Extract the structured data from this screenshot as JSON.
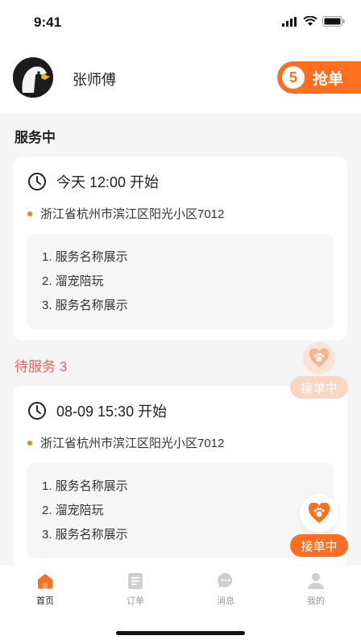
{
  "status_bar": {
    "time": "9:41"
  },
  "header": {
    "user_name": "张师傅",
    "grab_count": "5",
    "grab_label": "抢单"
  },
  "sections": {
    "in_service_title": "服务中",
    "pending_title": "待服务 3"
  },
  "orders": [
    {
      "time": "今天 12:00 开始",
      "address": "浙江省杭州市滨江区阳光小区7012",
      "services": [
        "1. 服务名称展示",
        "2. 溜宠陪玩",
        "3. 服务名称展示"
      ]
    },
    {
      "time": "08-09 15:30 开始",
      "address": "浙江省杭州市滨江区阳光小区7012",
      "services": [
        "1. 服务名称展示",
        "2. 溜宠陪玩",
        "3. 服务名称展示"
      ]
    }
  ],
  "floating": {
    "inactive_label": "接单中",
    "active_label": "接单中"
  },
  "tabbar": {
    "items": [
      {
        "label": "首页",
        "icon": "home-icon"
      },
      {
        "label": "订单",
        "icon": "order-icon"
      },
      {
        "label": "消息",
        "icon": "message-icon"
      },
      {
        "label": "我的",
        "icon": "profile-icon"
      }
    ],
    "active_index": 0
  },
  "colors": {
    "accent": "#ff6f1f",
    "pending_title": "#f25a5a",
    "inactive_float": "#fbd6c3"
  }
}
